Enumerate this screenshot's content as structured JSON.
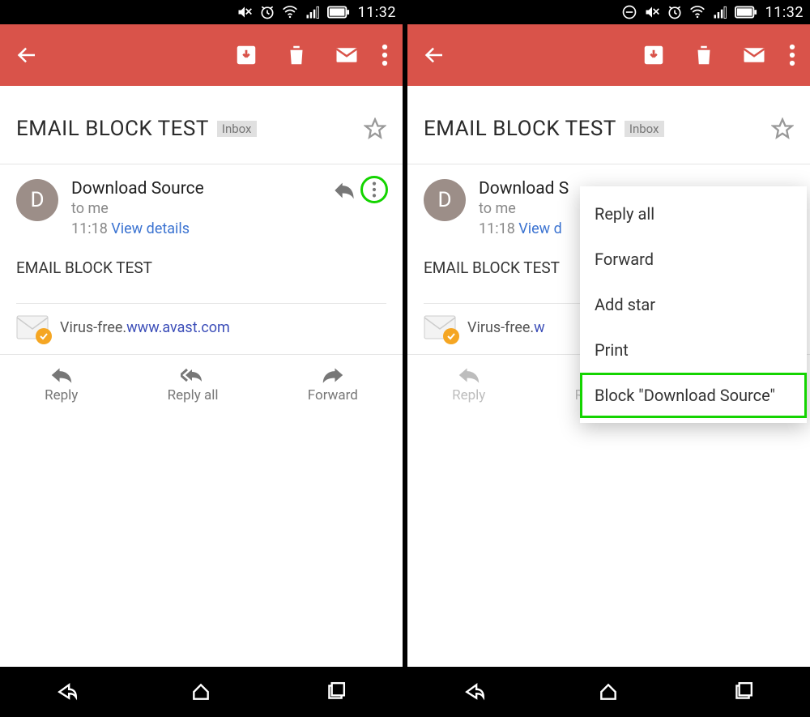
{
  "status": {
    "time": "11:32"
  },
  "appbar": {},
  "subject": {
    "title": "EMAIL BLOCK TEST",
    "tag": "Inbox"
  },
  "sender": {
    "initial": "D",
    "name": "Download Source",
    "to": "to me",
    "time": "11:18 ",
    "view_details": "View details",
    "name_trunc": "Download S",
    "view_trunc": "View d"
  },
  "body": {
    "text": "EMAIL BLOCK TEST"
  },
  "avast": {
    "text": "Virus-free. ",
    "link": "www.avast.com",
    "link_trunc": "w"
  },
  "actions": {
    "reply": "Reply",
    "reply_all": "Reply all",
    "forward": "Forward"
  },
  "menu": {
    "items": {
      "reply_all": "Reply all",
      "forward": "Forward",
      "add_star": "Add star",
      "print": "Print",
      "block": "Block \"Download Source\""
    }
  }
}
